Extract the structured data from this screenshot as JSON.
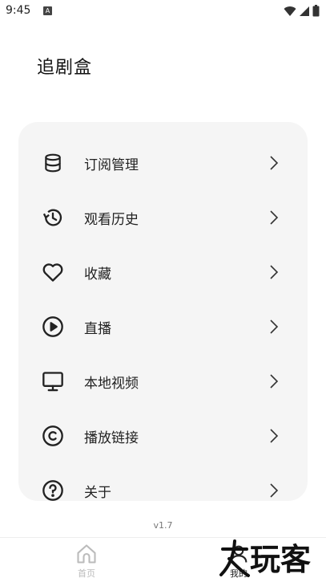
{
  "status_bar": {
    "time": "9:45",
    "notification_badge": "A",
    "icons": [
      "wifi-icon",
      "signal-icon",
      "battery-icon"
    ]
  },
  "header": {
    "title": "追剧盒"
  },
  "menu": {
    "items": [
      {
        "label": "订阅管理",
        "icon": "database-icon"
      },
      {
        "label": "观看历史",
        "icon": "history-icon"
      },
      {
        "label": "收藏",
        "icon": "heart-icon"
      },
      {
        "label": "直播",
        "icon": "play-circle-icon"
      },
      {
        "label": "本地视频",
        "icon": "monitor-icon"
      },
      {
        "label": "播放链接",
        "icon": "copyright-icon"
      },
      {
        "label": "关于",
        "icon": "help-circle-icon"
      }
    ]
  },
  "footer": {
    "version": "v1.7"
  },
  "bottom_nav": {
    "items": [
      {
        "label": "首页",
        "icon": "home-icon",
        "active": false
      },
      {
        "label": "我的",
        "icon": "user-icon",
        "active": true
      }
    ]
  },
  "watermark": {
    "text": "玩客"
  },
  "colors": {
    "card_bg": "#f5f5f5",
    "text": "#222222",
    "inactive": "#bbbbbb"
  }
}
